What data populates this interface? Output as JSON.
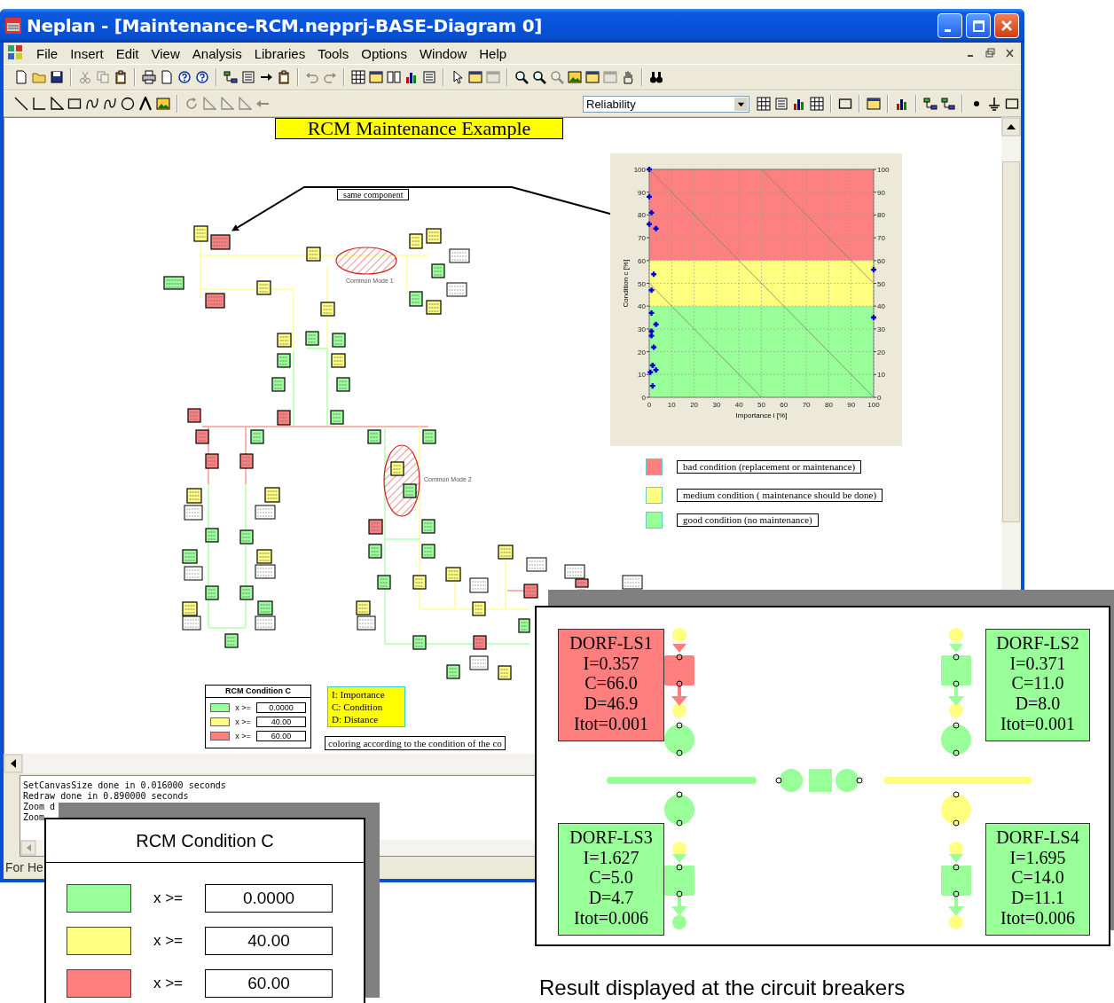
{
  "window": {
    "title": "Neplan - [Maintenance-RCM.nepprj-BASE-Diagram 0]"
  },
  "menu": [
    "File",
    "Insert",
    "Edit",
    "View",
    "Analysis",
    "Libraries",
    "Tools",
    "Options",
    "Window",
    "Help"
  ],
  "toolbars": [
    [
      {
        "kind": "page",
        "disabled": false
      },
      {
        "kind": "folder",
        "disabled": false
      },
      {
        "kind": "disk",
        "disabled": false
      },
      {
        "kind": "separator"
      },
      {
        "kind": "scissors",
        "disabled": true
      },
      {
        "kind": "copy",
        "disabled": true
      },
      {
        "kind": "paste",
        "disabled": false
      },
      {
        "kind": "separator"
      },
      {
        "kind": "printer",
        "disabled": false
      },
      {
        "kind": "page",
        "disabled": false
      },
      {
        "kind": "help",
        "disabled": false
      },
      {
        "kind": "help",
        "disabled": false
      },
      {
        "kind": "separator"
      },
      {
        "kind": "tree",
        "disabled": false
      },
      {
        "kind": "list",
        "disabled": false
      },
      {
        "kind": "arrow",
        "disabled": false
      },
      {
        "kind": "paste",
        "disabled": false
      },
      {
        "kind": "separator"
      },
      {
        "kind": "undo",
        "disabled": true
      },
      {
        "kind": "redo",
        "disabled": true
      },
      {
        "kind": "separator"
      },
      {
        "kind": "grid",
        "disabled": false
      },
      {
        "kind": "window",
        "disabled": false
      },
      {
        "kind": "columns",
        "disabled": false
      },
      {
        "kind": "chart",
        "disabled": false
      },
      {
        "kind": "list",
        "disabled": false
      },
      {
        "kind": "separator"
      },
      {
        "kind": "pointer",
        "disabled": false
      },
      {
        "kind": "window",
        "disabled": false
      },
      {
        "kind": "window",
        "disabled": true
      },
      {
        "kind": "separator"
      },
      {
        "kind": "magnifier",
        "disabled": false
      },
      {
        "kind": "magnifier",
        "disabled": false
      },
      {
        "kind": "magnifier",
        "disabled": true
      },
      {
        "kind": "image",
        "disabled": false
      },
      {
        "kind": "window",
        "disabled": false
      },
      {
        "kind": "window",
        "disabled": true
      },
      {
        "kind": "hand",
        "disabled": false
      },
      {
        "kind": "separator"
      },
      {
        "kind": "binoculars",
        "disabled": false
      }
    ],
    [
      {
        "kind": "line",
        "disabled": false
      },
      {
        "kind": "angle",
        "disabled": false
      },
      {
        "kind": "triangle",
        "disabled": false
      },
      {
        "kind": "rect",
        "disabled": false
      },
      {
        "kind": "curve",
        "disabled": false
      },
      {
        "kind": "curve",
        "disabled": false
      },
      {
        "kind": "circle",
        "disabled": false
      },
      {
        "kind": "textTool",
        "disabled": false
      },
      {
        "kind": "image",
        "disabled": false
      },
      {
        "kind": "separator"
      },
      {
        "kind": "rotate",
        "disabled": true
      },
      {
        "kind": "triangle",
        "disabled": true
      },
      {
        "kind": "triangle",
        "disabled": true
      },
      {
        "kind": "triangle",
        "disabled": true
      },
      {
        "kind": "arrowLeft",
        "disabled": true
      },
      {
        "kind": "dropdown",
        "value": "Reliability"
      },
      {
        "kind": "grid",
        "disabled": false
      },
      {
        "kind": "list",
        "disabled": false
      },
      {
        "kind": "chart",
        "disabled": false
      },
      {
        "kind": "grid",
        "disabled": false
      },
      {
        "kind": "separator"
      },
      {
        "kind": "rect",
        "disabled": false
      },
      {
        "kind": "separator"
      },
      {
        "kind": "window",
        "disabled": false
      },
      {
        "kind": "separator"
      },
      {
        "kind": "chart",
        "disabled": false
      },
      {
        "kind": "separator"
      },
      {
        "kind": "tree",
        "disabled": false
      },
      {
        "kind": "tree",
        "disabled": false
      },
      {
        "kind": "separator"
      },
      {
        "kind": "dot",
        "disabled": false
      },
      {
        "kind": "ground",
        "disabled": false
      },
      {
        "kind": "rect",
        "disabled": false
      }
    ]
  ],
  "diagram": {
    "title": "RCM Maintenance Example",
    "callout": "same component",
    "common_modes": [
      "Common Mode 1",
      "Common Mode 2"
    ],
    "nodes": [
      {
        "color": "#ffff80"
      },
      {
        "color": "#ff7f7f"
      },
      {
        "color": "#99ff99"
      },
      {
        "color": "#ff7f7f"
      },
      {
        "color": "#ffff80"
      },
      {
        "color": "#ffff80"
      },
      {
        "color": "#ffff80"
      },
      {
        "color": "#ffff80"
      },
      {
        "color": "#99ff99"
      },
      {
        "color": "#99ff99"
      },
      {
        "color": "#ffff80"
      },
      {
        "color": "#ffff80"
      },
      {
        "color": "#ffff80"
      },
      {
        "color": "#99ff99"
      },
      {
        "color": "#99ff99"
      },
      {
        "color": "#99ff99"
      },
      {
        "color": "#ffff80"
      },
      {
        "color": "#99ff99"
      },
      {
        "color": "#99ff99"
      },
      {
        "color": "#ff7f7f"
      },
      {
        "color": "#ff7f7f"
      },
      {
        "color": "#99ff99"
      },
      {
        "color": "#ff7f7f"
      },
      {
        "color": "#99ff99"
      },
      {
        "color": "#99ff99"
      },
      {
        "color": "#99ff99"
      },
      {
        "color": "#ff7f7f"
      },
      {
        "color": "#ff7f7f"
      },
      {
        "color": "#ffff80"
      },
      {
        "color": "#ffff80"
      },
      {
        "color": "#99ff99"
      },
      {
        "color": "#99ff99"
      },
      {
        "color": "#99ff99"
      },
      {
        "color": "#ffff80"
      },
      {
        "color": "#99ff99"
      },
      {
        "color": "#99ff99"
      },
      {
        "color": "#ffff80"
      },
      {
        "color": "#99ff99"
      },
      {
        "color": "#99ff99"
      },
      {
        "color": "#ffff80"
      },
      {
        "color": "#99ff99"
      },
      {
        "color": "#ff7f7f"
      },
      {
        "color": "#99ff99"
      },
      {
        "color": "#99ff99"
      },
      {
        "color": "#99ff99"
      },
      {
        "color": "#99ff99"
      },
      {
        "color": "#ffff80"
      },
      {
        "color": "#ffff80"
      },
      {
        "color": "#ffff80"
      },
      {
        "color": "#ff7f7f"
      },
      {
        "color": "#ff7f7f"
      },
      {
        "color": "#ffff80"
      },
      {
        "color": "#ffff80"
      },
      {
        "color": "#99ff99"
      },
      {
        "color": "#ff7f7f"
      },
      {
        "color": "#99ff99"
      },
      {
        "color": "#ffff80"
      },
      {
        "color": "#99ff99"
      }
    ],
    "chart_data": {
      "type": "scatter",
      "xlabel": "Importance i [%]",
      "ylabel": "Condition c [%]",
      "xlim": [
        0,
        100
      ],
      "ylim": [
        0,
        100
      ],
      "xticks": [
        0,
        10,
        20,
        30,
        40,
        50,
        60,
        70,
        80,
        90,
        100
      ],
      "yticks": [
        0,
        10,
        20,
        30,
        40,
        50,
        60,
        70,
        80,
        90,
        100
      ],
      "x": [
        0,
        0,
        1,
        0,
        3,
        2,
        1,
        1,
        3,
        1,
        1,
        2,
        1.5,
        3,
        0.5,
        1.5,
        100,
        100
      ],
      "series": [
        {
          "color": "#0000cc",
          "values": [
            100,
            88,
            81,
            76,
            74,
            54,
            47,
            37,
            32,
            29,
            27,
            22,
            14,
            12,
            11,
            5,
            56,
            35
          ]
        }
      ],
      "grid": true,
      "y2lim": [
        0,
        100
      ],
      "y2ticks": [
        0,
        10,
        20,
        30,
        40,
        50,
        60,
        70,
        80,
        90,
        100
      ],
      "bands": [
        {
          "axis": "y",
          "from": 60,
          "to": 100,
          "color": "#ff8080"
        },
        {
          "axis": "y",
          "from": 40,
          "to": 60,
          "color": "#ffff80"
        },
        {
          "axis": "y",
          "from": 0,
          "to": 40,
          "color": "#99ff99"
        }
      ]
    },
    "condition_legend": [
      {
        "color": "#ff7f7f",
        "label": "bad condition (replacement or maintenance)"
      },
      {
        "color": "#ffff80",
        "label": "medium condition ( maintenance should be done)"
      },
      {
        "color": "#99ff99",
        "label": "good condition (no maintenance)"
      }
    ],
    "mini_legend": {
      "title": "RCM Condition C",
      "rows": [
        {
          "color": "#99ff99",
          "operator": "x >=",
          "value": "0.0000"
        },
        {
          "color": "#ffff80",
          "operator": "x >=",
          "value": "40.00"
        },
        {
          "color": "#ff7f7f",
          "operator": "x >=",
          "value": "60.00"
        }
      ]
    },
    "abbreviations": [
      "I: Importance",
      "C: Condition",
      "D: Distance"
    ],
    "note": "coloring according to the condition of the co"
  },
  "log": [
    "SetCanvasSize done in 0.016000 seconds",
    "Redraw done in 0.890000 seconds",
    "Zoom d",
    "Zoom"
  ],
  "status_bar": "For He",
  "condition_inset": {
    "title": "RCM Condition C",
    "rows": [
      {
        "color": "#99ff99",
        "operator": "x >=",
        "value": "0.0000"
      },
      {
        "color": "#ffff80",
        "operator": "x >=",
        "value": "40.00"
      },
      {
        "color": "#ff7f7f",
        "operator": "x >=",
        "value": "60.00"
      }
    ]
  },
  "breaker_inset": {
    "breakers": [
      {
        "color": "#ff7f7f",
        "lines": [
          "DORF-LS1",
          "I=0.357",
          "C=66.0",
          "D=46.9",
          "Itot=0.001"
        ]
      },
      {
        "color": "#99ff99",
        "lines": [
          "DORF-LS2",
          "I=0.371",
          "C=11.0",
          "D=8.0",
          "Itot=0.001"
        ]
      },
      {
        "color": "#99ff99",
        "lines": [
          "DORF-LS3",
          "I=1.627",
          "C=5.0",
          "D=4.7",
          "Itot=0.006"
        ]
      },
      {
        "color": "#99ff99",
        "lines": [
          "DORF-LS4",
          "I=1.695",
          "C=14.0",
          "D=11.1",
          "Itot=0.006"
        ]
      }
    ]
  },
  "caption": "Result displayed at the circuit breakers"
}
